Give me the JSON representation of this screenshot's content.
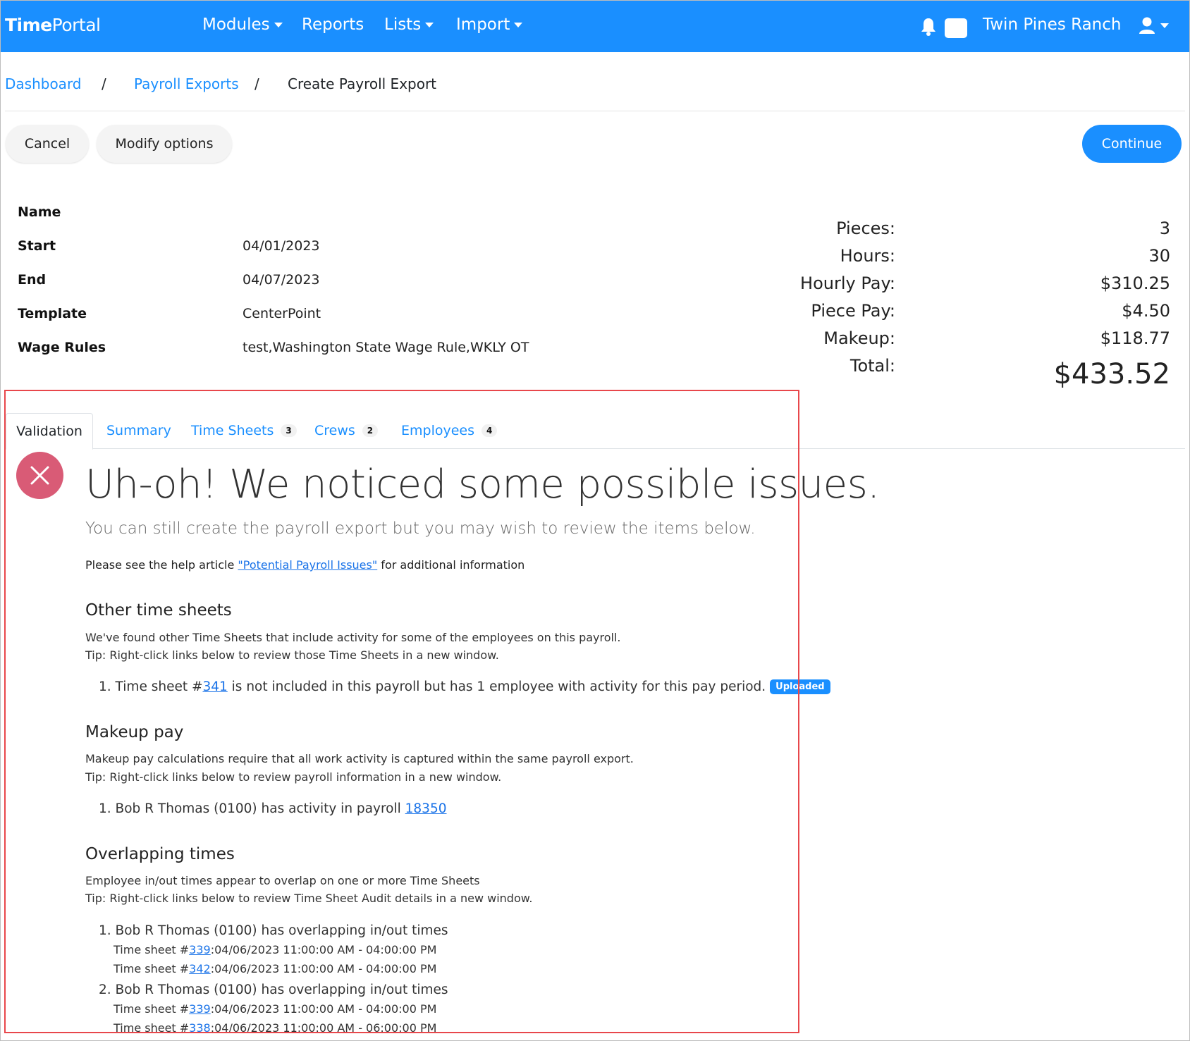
{
  "navbar": {
    "brand_bold": "Time",
    "brand_light": "Portal",
    "menu": [
      {
        "label": "Modules",
        "dropdown": true
      },
      {
        "label": "Reports",
        "dropdown": false
      },
      {
        "label": "Lists",
        "dropdown": true
      },
      {
        "label": "Import",
        "dropdown": true
      }
    ],
    "org_name": "Twin Pines Ranch",
    "icons": [
      "bell-icon",
      "chat-icon",
      "user-icon"
    ],
    "bg_color": "#1a8fff"
  },
  "breadcrumb": {
    "items": [
      "Dashboard",
      "Payroll Exports",
      "Create Payroll Export"
    ],
    "separator": "/"
  },
  "actions": {
    "cancel": "Cancel",
    "modify": "Modify options",
    "continue": "Continue"
  },
  "details": {
    "rows": [
      {
        "label": "Name",
        "value": ""
      },
      {
        "label": "Start",
        "value": "04/01/2023"
      },
      {
        "label": "End",
        "value": "04/07/2023"
      },
      {
        "label": "Template",
        "value": "CenterPoint"
      },
      {
        "label": "Wage Rules",
        "value": "test,Washington State Wage Rule,WKLY OT"
      }
    ]
  },
  "totals": {
    "rows": [
      {
        "label": "Pieces:",
        "value": "3"
      },
      {
        "label": "Hours:",
        "value": "30"
      },
      {
        "label": "Hourly Pay:",
        "value": "$310.25"
      },
      {
        "label": "Piece Pay:",
        "value": "$4.50"
      },
      {
        "label": "Makeup:",
        "value": "$118.77"
      },
      {
        "label": "Total:",
        "value": "$433.52"
      }
    ]
  },
  "tabs": [
    {
      "label": "Validation",
      "badge": "",
      "active": true
    },
    {
      "label": "Summary",
      "badge": "",
      "active": false
    },
    {
      "label": "Time Sheets",
      "badge": "3",
      "active": false
    },
    {
      "label": "Crews",
      "badge": "2",
      "active": false
    },
    {
      "label": "Employees",
      "badge": "4",
      "active": false
    }
  ],
  "validation": {
    "headline": "Uh-oh! We noticed some possible issues.",
    "subhead": "You can still create the payroll export but you may wish to review the items below.",
    "help_pre": "Please see the help article ",
    "help_link": "\"Potential Payroll Issues\"",
    "help_post": " for additional information",
    "sections": {
      "other": {
        "title": "Other time sheets",
        "desc1": "We've found other Time Sheets that include activity for some of the employees on this payroll.",
        "desc2": "Tip: Right-click links below to review those Time Sheets in a new window.",
        "item_num": "1.",
        "item_pre": "Time sheet #",
        "item_link": "341",
        "item_post": " is not included in this payroll but has 1 employee with activity for this pay period.",
        "item_badge": "Uploaded"
      },
      "makeup": {
        "title": "Makeup pay",
        "desc1": "Makeup pay calculations require that all work activity is captured within the same payroll export.",
        "desc2": "Tip: Right-click links below to review payroll information in a new window.",
        "item_num": "1.",
        "item_pre": "Bob R Thomas (0100) has activity in payroll ",
        "item_link": "18350"
      },
      "overlap": {
        "title": "Overlapping times",
        "desc1": "Employee in/out times appear to overlap on one or more Time Sheets",
        "desc2": "Tip: Right-click links below to review Time Sheet Audit details in a new window.",
        "items": [
          {
            "num": "1.",
            "text": "Bob R Thomas (0100) has overlapping in/out times",
            "sheets": [
              {
                "pre": "Time sheet #",
                "link": "339",
                "post": ":04/06/2023 11:00:00 AM - 04:00:00 PM"
              },
              {
                "pre": "Time sheet #",
                "link": "342",
                "post": ":04/06/2023 11:00:00 AM - 04:00:00 PM"
              }
            ]
          },
          {
            "num": "2.",
            "text": "Bob R Thomas (0100) has overlapping in/out times",
            "sheets": [
              {
                "pre": "Time sheet #",
                "link": "339",
                "post": ":04/06/2023 11:00:00 AM - 04:00:00 PM"
              },
              {
                "pre": "Time sheet #",
                "link": "338",
                "post": ":04/06/2023 11:00:00 AM - 06:00:00 PM"
              }
            ]
          }
        ]
      }
    }
  },
  "highlight_color": "#e8474b"
}
